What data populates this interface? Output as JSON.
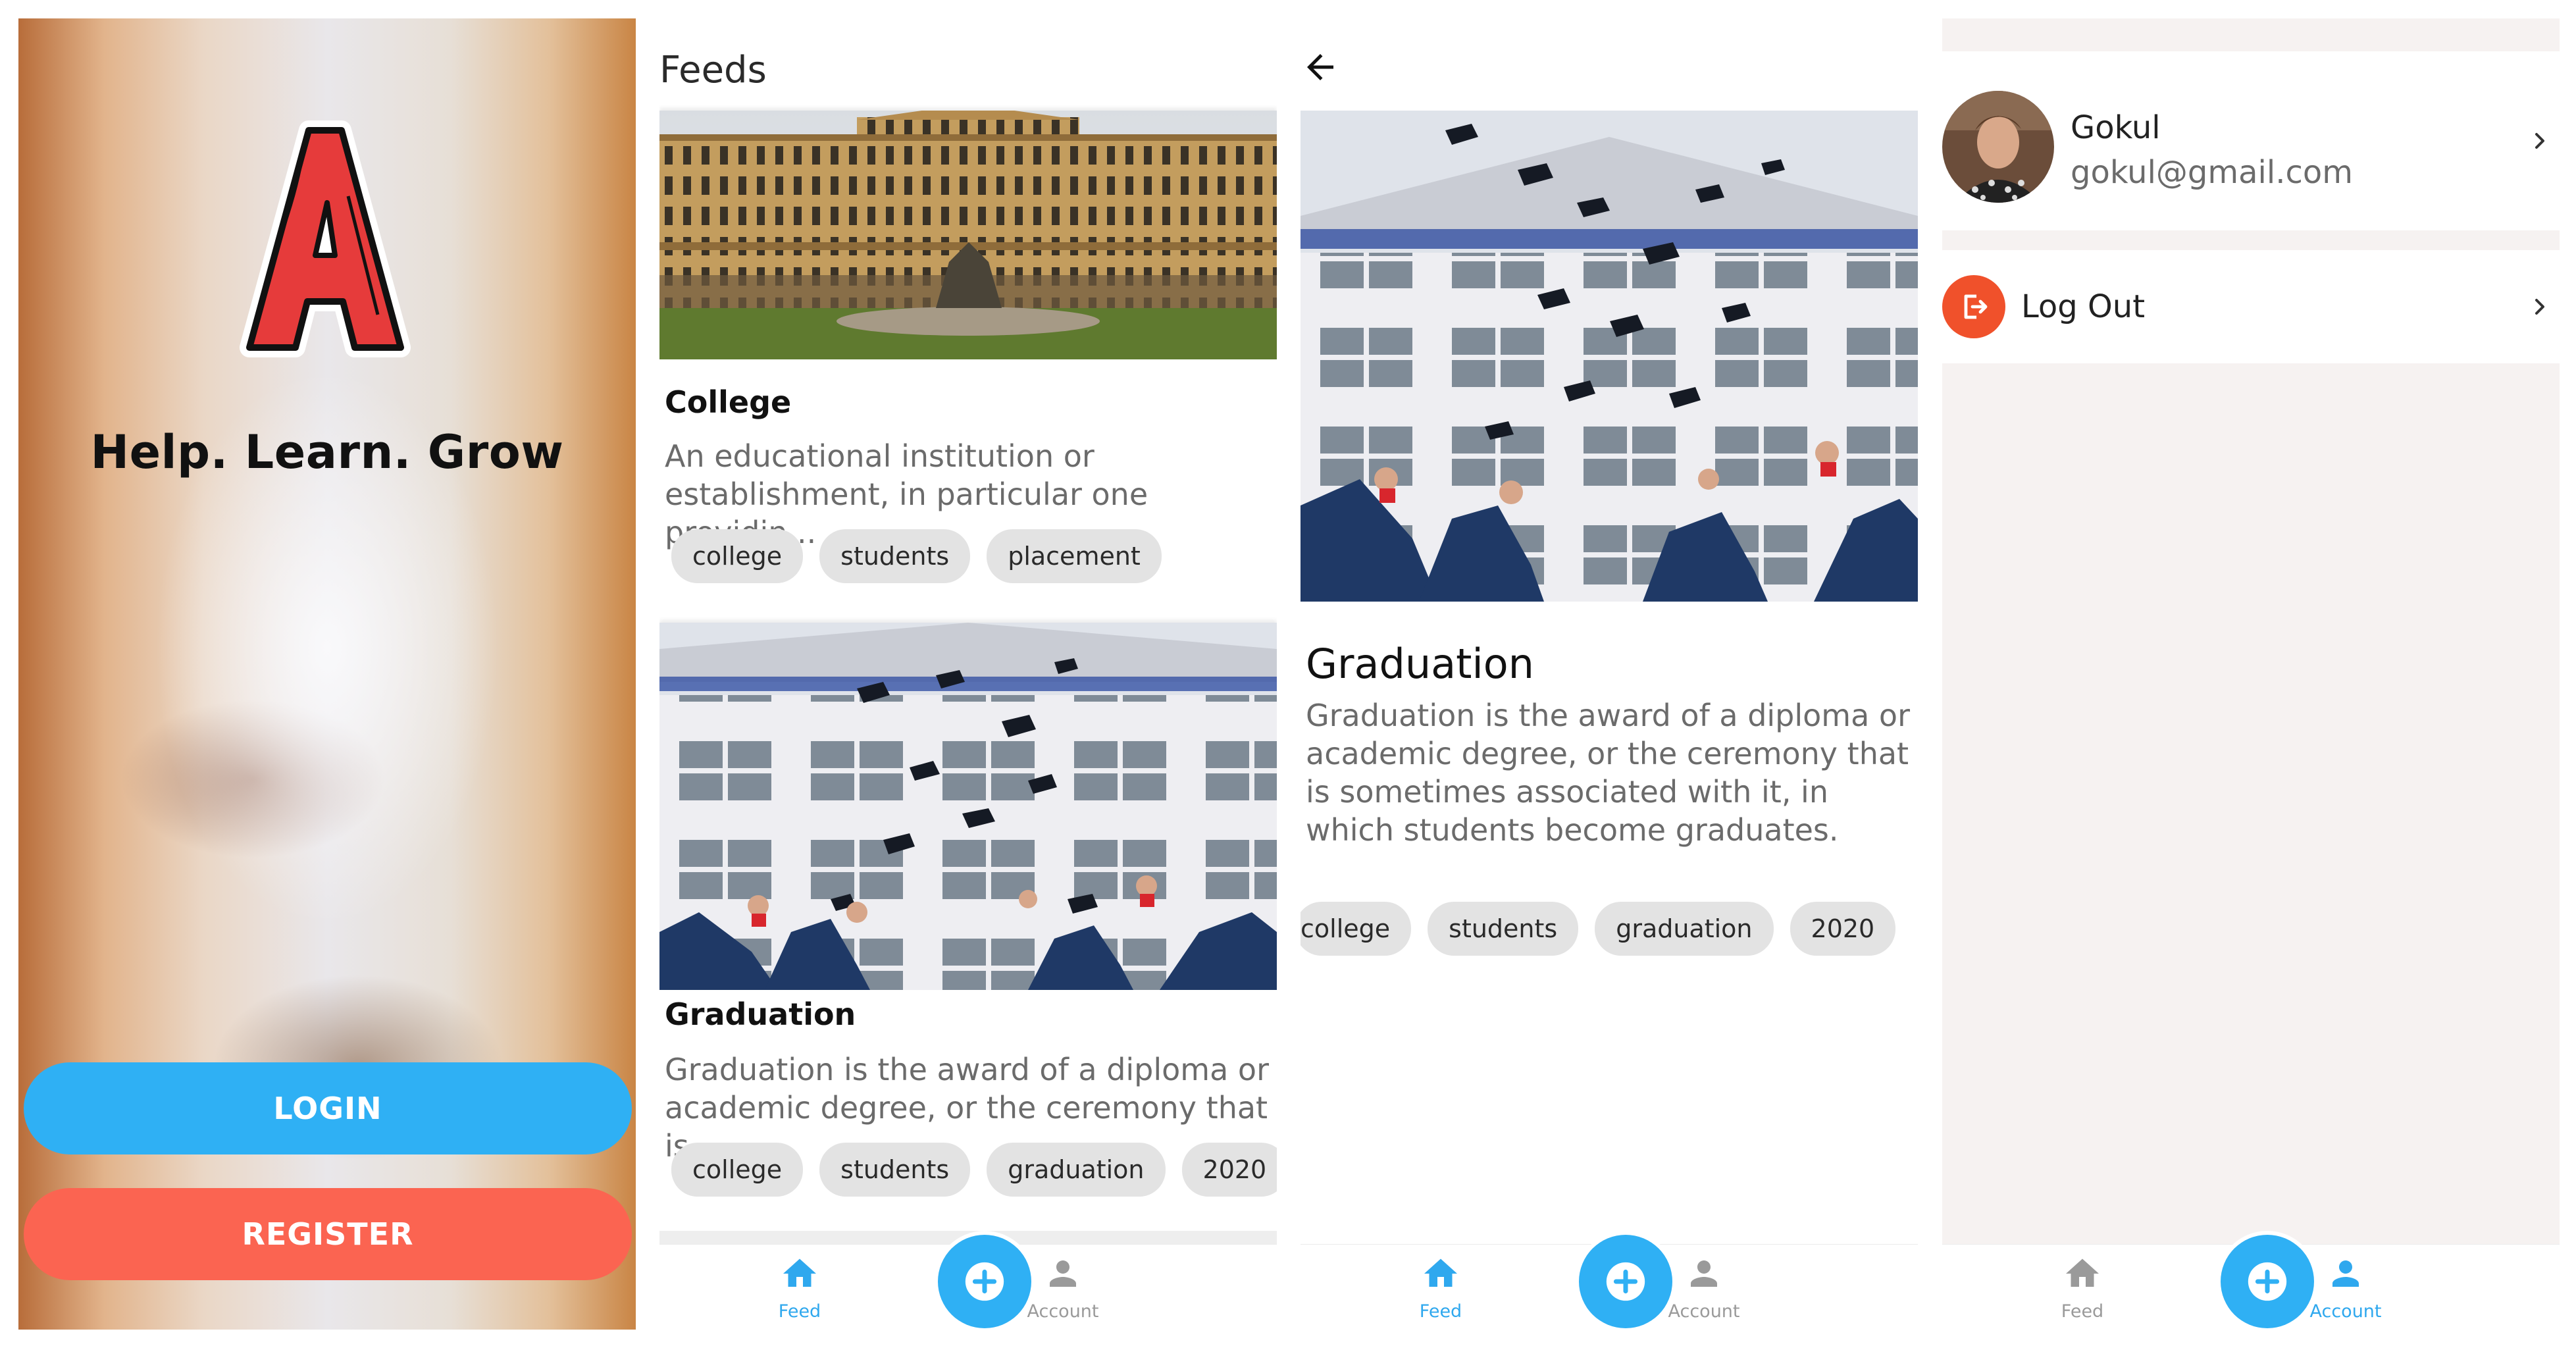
{
  "welcome": {
    "tagline": "Help. Learn. Grow",
    "login_label": "LOGIN",
    "register_label": "REGISTER"
  },
  "feeds": {
    "title": "Feeds",
    "posts": [
      {
        "title": "College",
        "description": "An educational institution or establishment, in particular one providin...",
        "tags": [
          "college",
          "students",
          "placement"
        ]
      },
      {
        "title": "Graduation",
        "description": "Graduation is the award of a diploma or academic degree, or the ceremony that is...",
        "tags": [
          "college",
          "students",
          "graduation",
          "2020"
        ]
      }
    ]
  },
  "detail": {
    "title": "Graduation",
    "description": "Graduation is the award of a diploma or academic degree, or the ceremony that is sometimes associated with it, in which students become graduates.",
    "tags": [
      "college",
      "students",
      "graduation",
      "2020"
    ]
  },
  "account": {
    "name": "Gokul",
    "email": "gokul@gmail.com",
    "logout_label": "Log Out"
  },
  "nav": {
    "feed_label": "Feed",
    "account_label": "Account"
  },
  "colors": {
    "primary": "#2fb0f4",
    "register": "#fb6451",
    "logout": "#f0512b",
    "inactive": "#9a9a9a"
  }
}
